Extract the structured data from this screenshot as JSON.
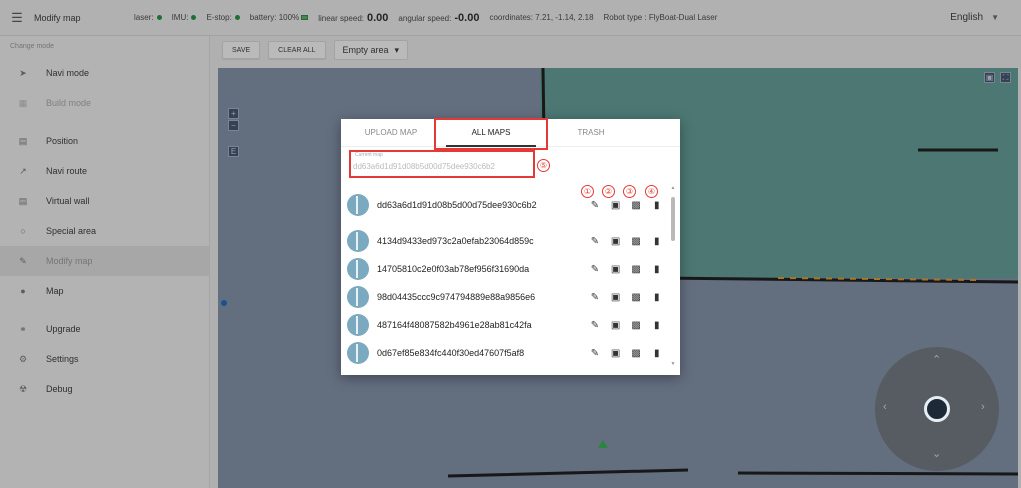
{
  "header": {
    "menu_icon": "menu-icon",
    "title": "Modify map",
    "laser_label": "laser:",
    "imu_label": "IMU:",
    "estop_label": "E-stop:",
    "battery_label": "battery:",
    "battery_value": "100%",
    "linear_speed_label": "linear speed:",
    "linear_speed_value": "0.00",
    "angular_speed_label": "angular speed:",
    "angular_speed_value": "-0.00",
    "coordinates_label": "coordinates:",
    "coordinates_value": "7.21, -1.14, 2.18",
    "robot_type_label": "Robot type : FlyBoat-Dual Laser",
    "language": "English",
    "status_color": "#1a8f3c"
  },
  "sidebar": {
    "heading": "Change mode",
    "items": [
      {
        "label": "Navi mode",
        "icon": "send-icon"
      },
      {
        "label": "Build mode",
        "icon": "build-icon"
      },
      {
        "label": "Position",
        "icon": "position-icon"
      },
      {
        "label": "Navi route",
        "icon": "route-icon"
      },
      {
        "label": "Virtual wall",
        "icon": "wall-icon"
      },
      {
        "label": "Special area",
        "icon": "area-icon"
      },
      {
        "label": "Modify map",
        "icon": "edit-icon"
      },
      {
        "label": "Map",
        "icon": "map-icon"
      },
      {
        "label": "Upgrade",
        "icon": "upgrade-icon"
      },
      {
        "label": "Settings",
        "icon": "gear-icon"
      },
      {
        "label": "Debug",
        "icon": "bug-icon"
      }
    ]
  },
  "toolbar": {
    "save_label": "SAVE",
    "clear_all_label": "CLEAR ALL",
    "area_select": "Empty area"
  },
  "dialog": {
    "tabs": [
      "UPLOAD MAP",
      "ALL MAPS",
      "TRASH"
    ],
    "current_map_label": "Current map",
    "current_map_value": "dd63a6d1d91d08b5d00d75dee930c6b2",
    "annotations": [
      "①",
      "②",
      "③",
      "④",
      "⑤"
    ],
    "maps": [
      "dd63a6d1d91d08b5d00d75dee930c6b2",
      "4134d9433ed973c2a0efab23064d859c",
      "14705810c2e0f03ab78ef956f31690da",
      "98d04435ccc9c974794889e88a9856e6",
      "487164f48087582b4961e28ab81c42fa",
      "0d67ef85e834fc440f30ed47607f5af8"
    ],
    "row_actions": [
      "edit-icon",
      "select-icon",
      "save-icon",
      "delete-icon"
    ],
    "highlight_color": "#e53935"
  },
  "joystick": {
    "icon": "joystick-icon"
  }
}
